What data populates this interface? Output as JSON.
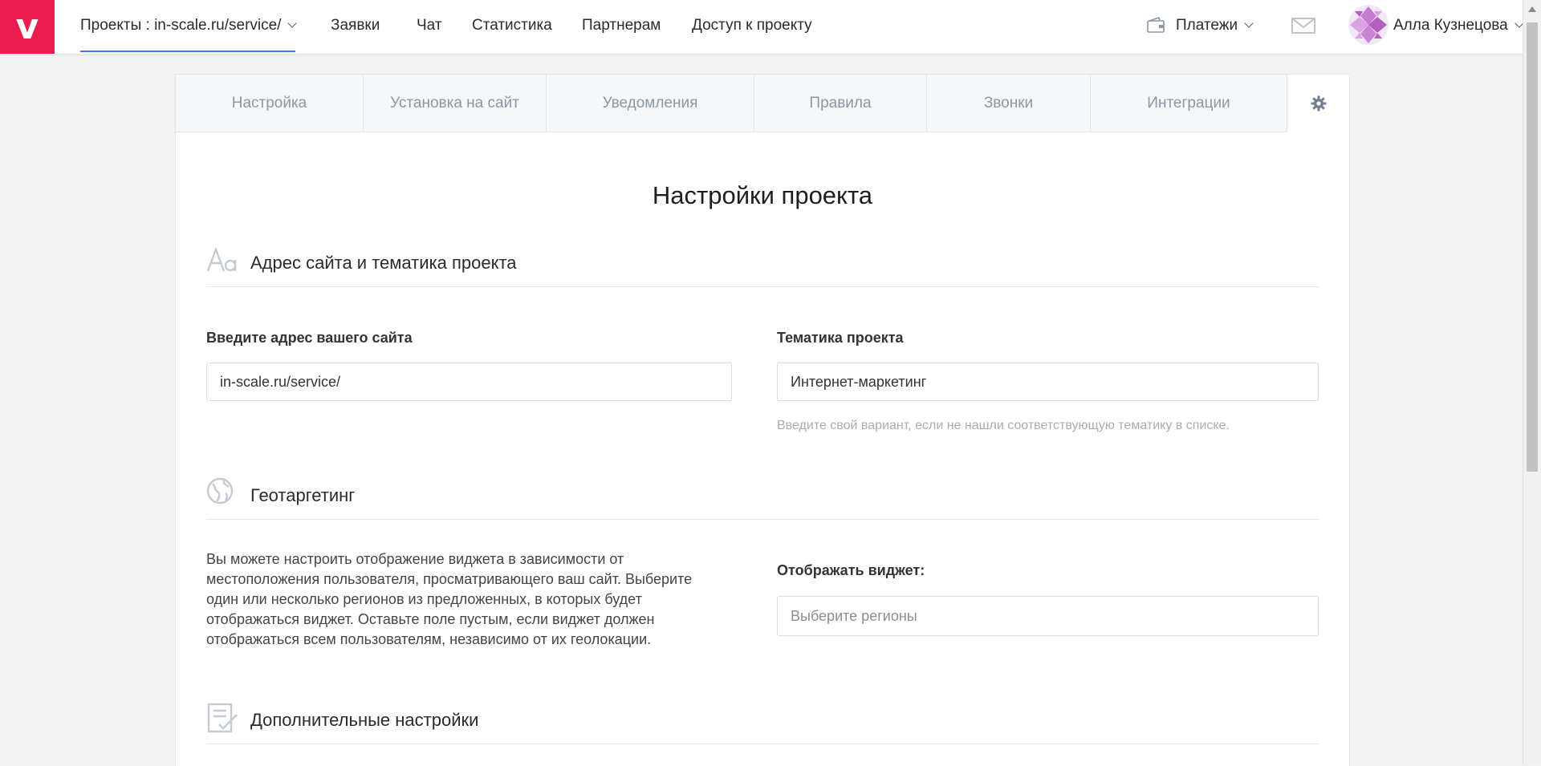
{
  "brand": {
    "logo_letter": "v",
    "accent": "#ec1c4f"
  },
  "topnav": {
    "project_label": "Проекты : in-scale.ru/service/",
    "items": [
      "Заявки",
      "Чат",
      "Статистика",
      "Партнерам",
      "Доступ к проекту"
    ],
    "payments_label": "Платежи",
    "user_name": "Алла Кузнецова"
  },
  "tabs": [
    "Настройка",
    "Установка на сайт",
    "Уведомления",
    "Правила",
    "Звонки",
    "Интеграции"
  ],
  "page_title": "Настройки проекта",
  "sections": {
    "site": {
      "title": "Адрес сайта и тематика проекта",
      "url_label": "Введите адрес вашего сайта",
      "url_value": "in-scale.ru/service/",
      "topic_label": "Тематика проекта",
      "topic_value": "Интернет-маркетинг",
      "topic_hint": "Введите свой вариант, если не нашли соответствующую тематику в списке."
    },
    "geo": {
      "title": "Геотаргетинг",
      "description": "Вы можете настроить отображение виджета в зависимости от местоположения пользователя, просматривающего ваш сайт. Выберите один или несколько регионов из предложенных, в которых будет отображаться виджет. Оставьте поле пустым, если виджет должен отображаться всем пользователям, независимо от их геолокации.",
      "show_label": "Отображать виджет:",
      "regions_placeholder": "Выберите регионы"
    },
    "extra": {
      "title": "Дополнительные настройки"
    }
  }
}
